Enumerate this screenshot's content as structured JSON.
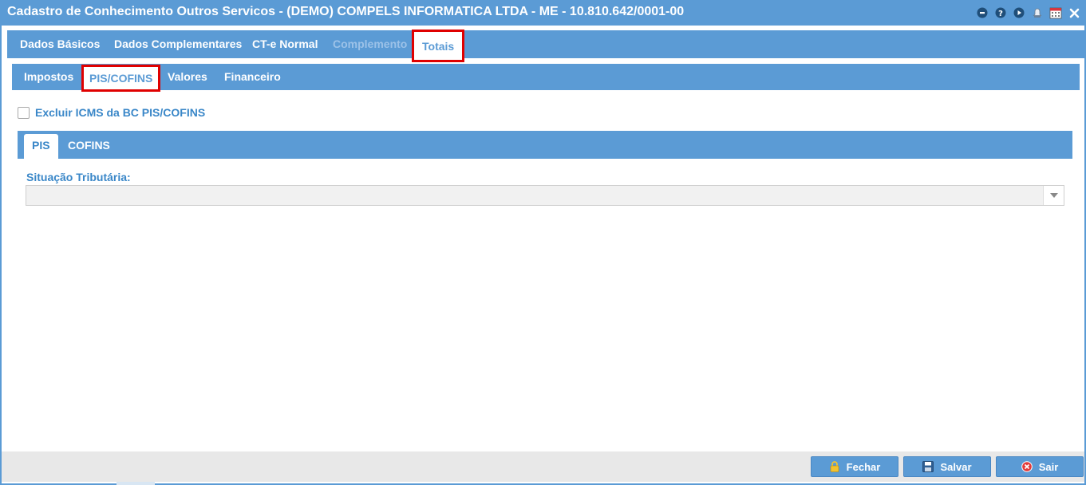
{
  "window": {
    "title": "Cadastro de Conhecimento Outros Servicos - (DEMO) COMPELS INFORMATICA LTDA - ME - 10.810.642/0001-00"
  },
  "title_icons": [
    "minimize-icon",
    "help-icon",
    "play-icon",
    "bell-icon",
    "calendar-icon",
    "close-icon"
  ],
  "main_tabs": [
    {
      "label": "Dados Básicos",
      "state": "normal"
    },
    {
      "label": "Dados Complementares",
      "state": "normal"
    },
    {
      "label": "CT-e Normal",
      "state": "normal"
    },
    {
      "label": "Complemento",
      "state": "disabled"
    },
    {
      "label": "Totais",
      "state": "active"
    }
  ],
  "sub_tabs": [
    {
      "label": "Impostos",
      "state": "normal"
    },
    {
      "label": "PIS/COFINS",
      "state": "active"
    },
    {
      "label": "Valores",
      "state": "normal"
    },
    {
      "label": "Financeiro",
      "state": "normal"
    }
  ],
  "exclude_icms": {
    "label": "Excluir ICMS da BC PIS/COFINS",
    "checked": false
  },
  "tax_tabs": [
    {
      "label": "PIS",
      "state": "active"
    },
    {
      "label": "COFINS",
      "state": "normal"
    }
  ],
  "situacao": {
    "label": "Situação Tributária:",
    "value": ""
  },
  "buttons": {
    "fechar": "Fechar",
    "salvar": "Salvar",
    "sair": "Sair"
  },
  "colors": {
    "accent": "#5b9bd5",
    "highlight": "#e00000",
    "label_text": "#3a87c8"
  }
}
